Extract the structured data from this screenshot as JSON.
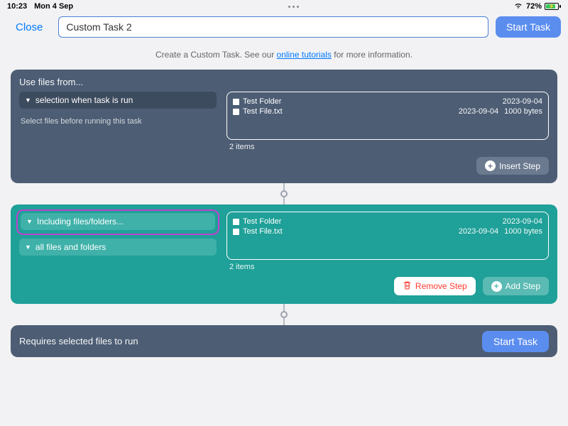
{
  "status": {
    "time": "10:23",
    "date": "Mon 4 Sep",
    "battery_pct": "72%"
  },
  "toolbar": {
    "close": "Close",
    "task_name": "Custom Task 2",
    "start": "Start Task"
  },
  "info": {
    "prefix": "Create a Custom Task. See our ",
    "link": "online tutorials",
    "suffix": " for more information."
  },
  "step1": {
    "title": "Use files from...",
    "pill": "selection when task is run",
    "hint": "Select files before running this task",
    "files": [
      {
        "name": "Test Folder",
        "date": "2023-09-04",
        "size": ""
      },
      {
        "name": "Test File.txt",
        "date": "2023-09-04",
        "size": "1000 bytes"
      }
    ],
    "count": "2 items",
    "insert": "Insert Step"
  },
  "step2": {
    "pill1": "Including files/folders...",
    "pill2": "all files and folders",
    "files": [
      {
        "name": "Test Folder",
        "date": "2023-09-04",
        "size": ""
      },
      {
        "name": "Test File.txt",
        "date": "2023-09-04",
        "size": "1000 bytes"
      }
    ],
    "count": "2 items",
    "remove": "Remove Step",
    "add": "Add Step"
  },
  "footer": {
    "requires": "Requires selected files to run",
    "start": "Start Task"
  }
}
